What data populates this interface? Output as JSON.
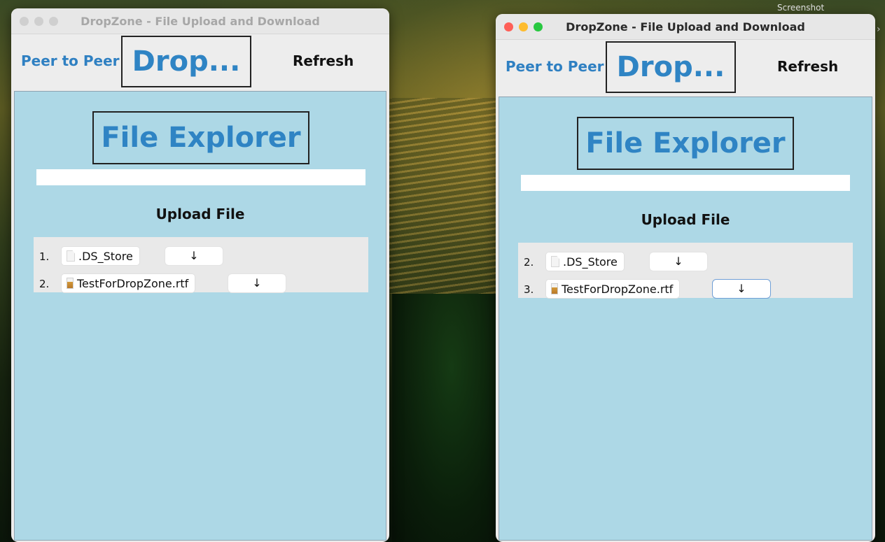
{
  "desktop": {
    "corner_text": "Screenshot"
  },
  "windows": [
    {
      "title": "DropZone - File Upload and Download",
      "nav_link": "Peer to Peer",
      "logo": "Drop...",
      "refresh": "Refresh",
      "heading": "File Explorer",
      "path_value": "",
      "upload_label": "Upload File",
      "files": [
        {
          "num": "1.",
          "name": ".DS_Store",
          "icon": "document-icon",
          "download": "↓"
        },
        {
          "num": "2.",
          "name": "TestForDropZone.rtf",
          "icon": "rtf-document-icon",
          "download": "↓"
        }
      ]
    },
    {
      "title": "DropZone - File Upload and Download",
      "nav_link": "Peer to Peer",
      "logo": "Drop...",
      "refresh": "Refresh",
      "heading": "File Explorer",
      "path_value": "",
      "upload_label": "Upload File",
      "files": [
        {
          "num": "2.",
          "name": ".DS_Store",
          "icon": "document-icon",
          "download": "↓"
        },
        {
          "num": "3.",
          "name": "TestForDropZone.rtf",
          "icon": "rtf-document-icon",
          "download": "↓"
        }
      ]
    }
  ],
  "colors": {
    "panel": "#add8e6",
    "accent_blue": "#2f84c4",
    "traffic_red": "#fe5f57",
    "traffic_yellow": "#febc2e",
    "traffic_green": "#28c840",
    "traffic_inactive": "#cfcfcf"
  }
}
